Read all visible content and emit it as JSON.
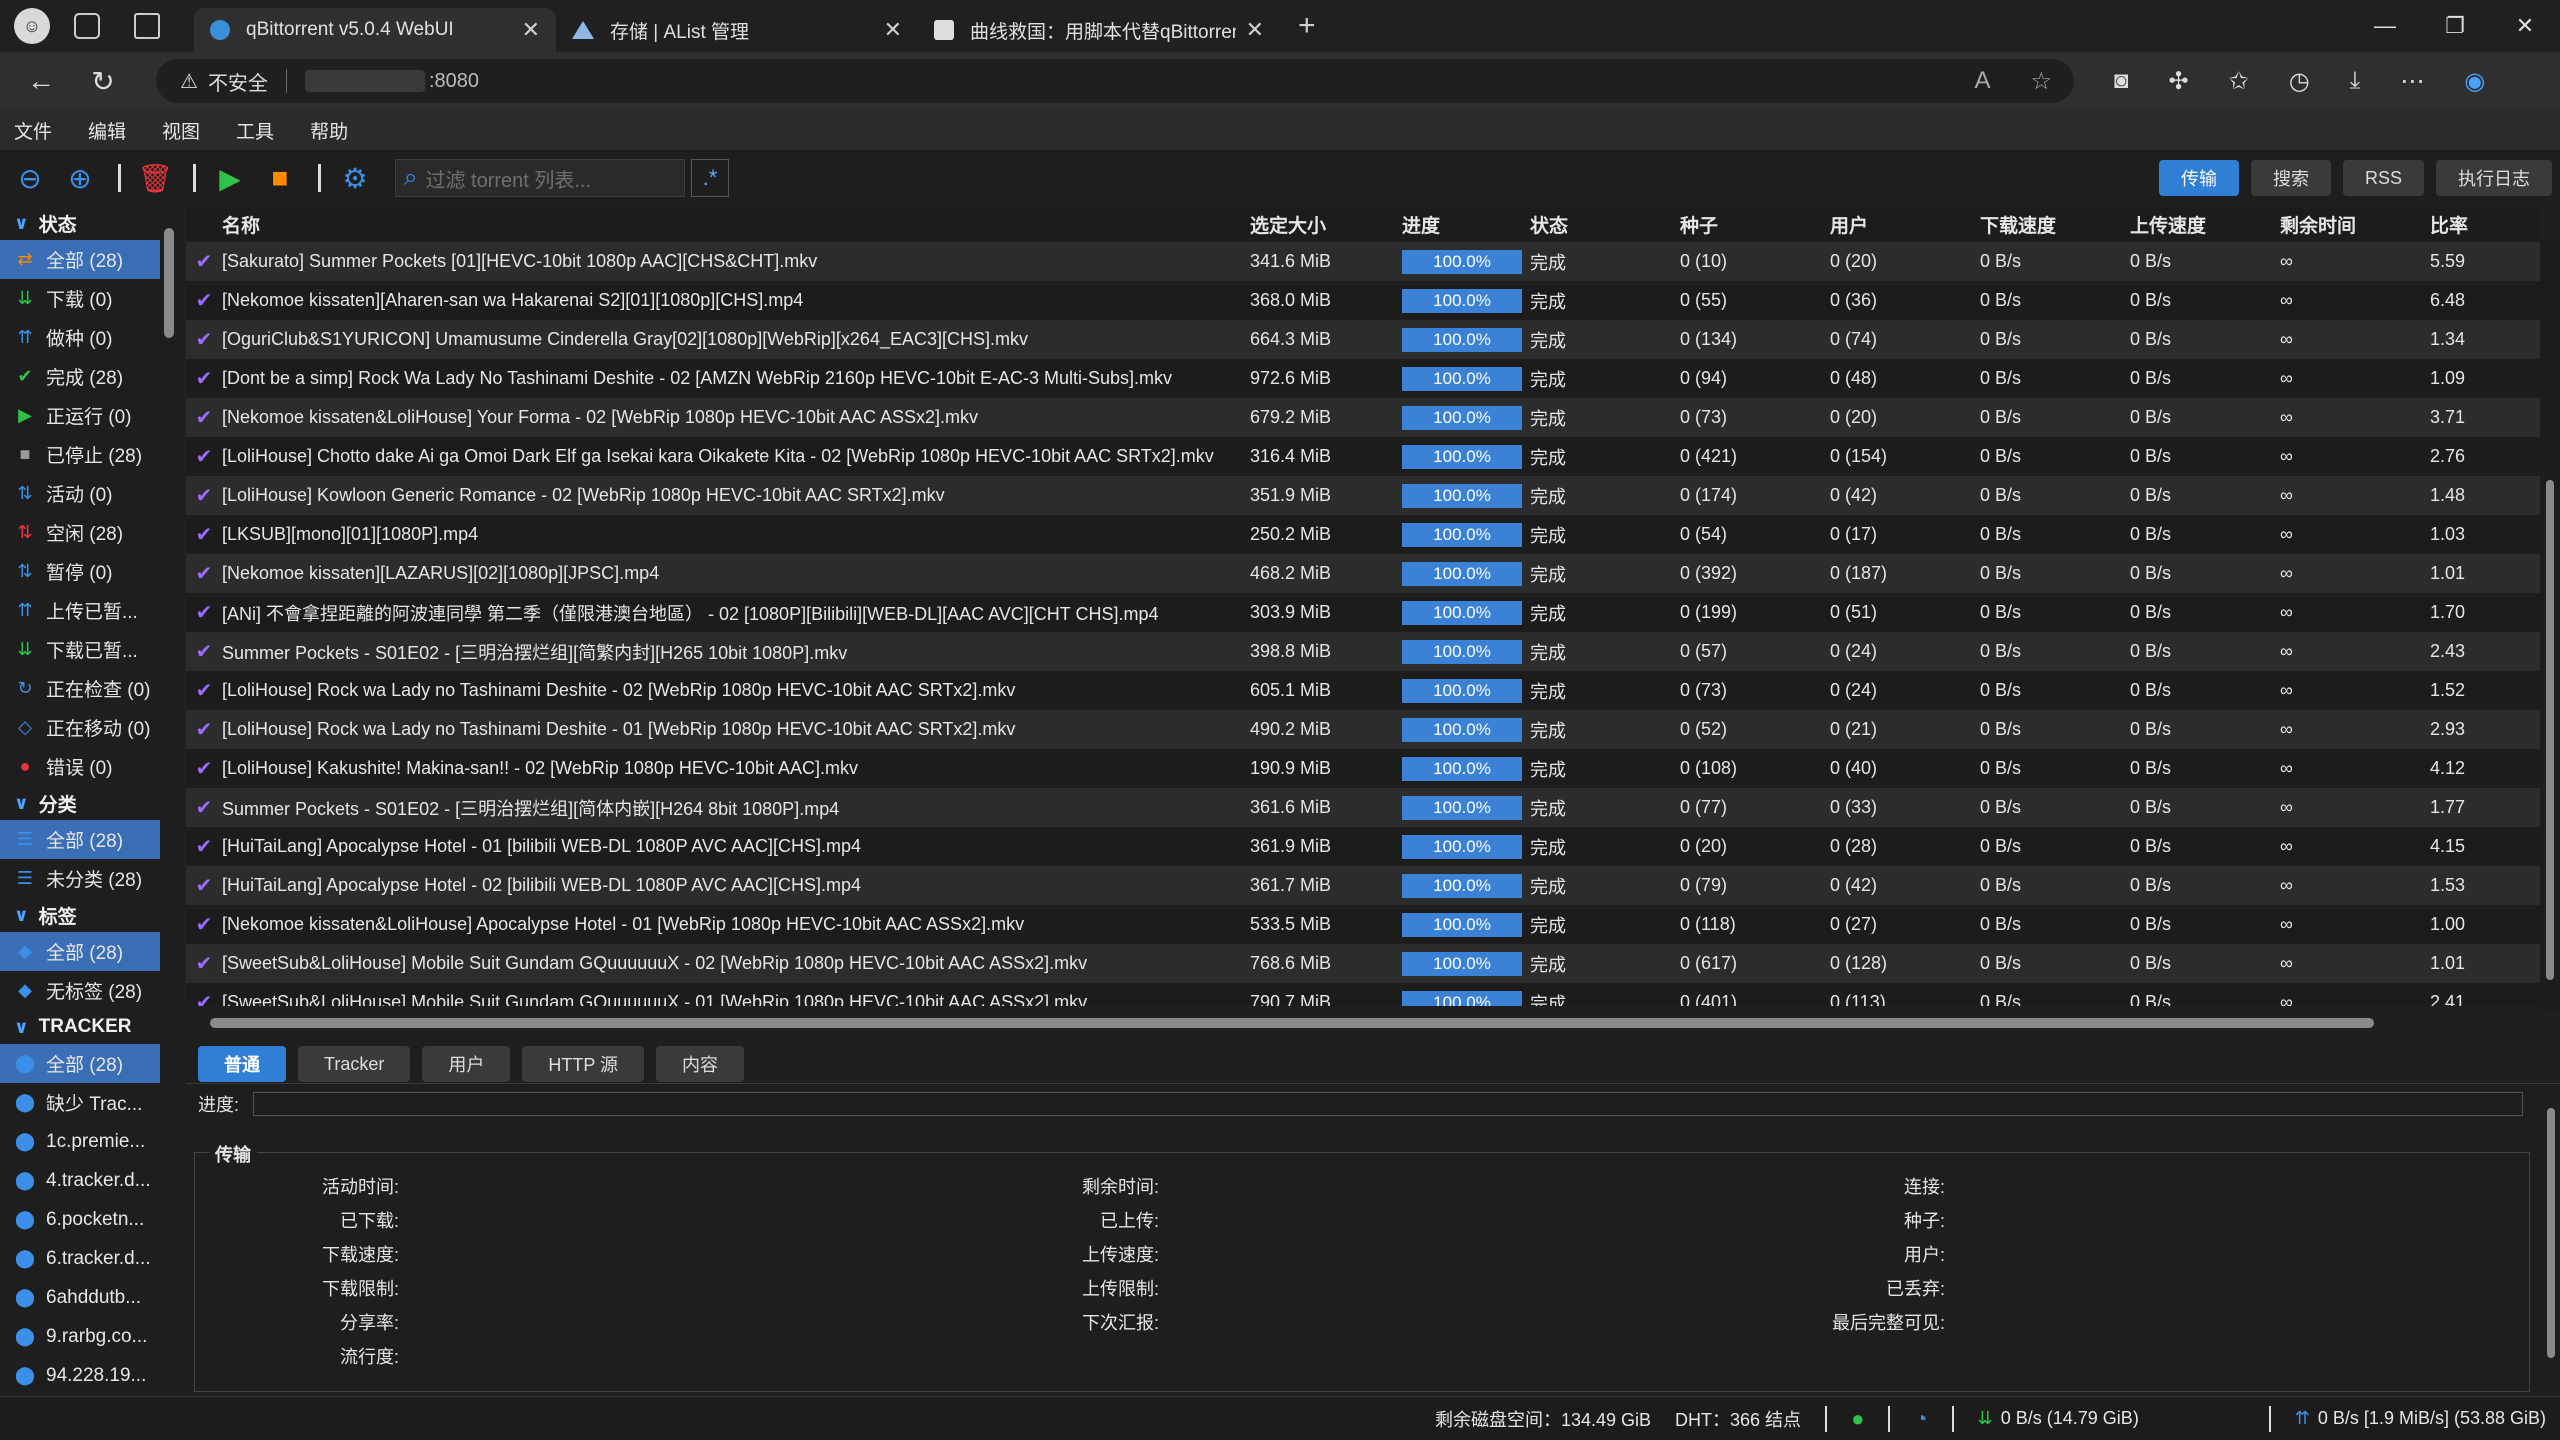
{
  "browser": {
    "tabs": [
      {
        "title": "qBittorrent v5.0.4 WebUI",
        "active": true
      },
      {
        "title": "存储 | AList 管理",
        "active": false
      },
      {
        "title": "曲线救国：用脚本代替qBittorrent",
        "active": false
      }
    ],
    "url_warning": "不安全",
    "url_port": ":8080"
  },
  "menu": [
    "文件",
    "编辑",
    "视图",
    "工具",
    "帮助"
  ],
  "toolbar": {
    "filter_placeholder": "过滤 torrent 列表...",
    "regex": ".*",
    "right_tabs": [
      "传输",
      "搜索",
      "RSS",
      "执行日志"
    ]
  },
  "sidebar": {
    "status_title": "状态",
    "status": [
      {
        "label": "全部 (28)",
        "icon": "shuffle-icon",
        "active": true
      },
      {
        "label": "下载 (0)",
        "icon": "download-icon"
      },
      {
        "label": "做种 (0)",
        "icon": "upload-icon"
      },
      {
        "label": "完成 (28)",
        "icon": "check-icon"
      },
      {
        "label": "正运行 (0)",
        "icon": "play-icon"
      },
      {
        "label": "已停止 (28)",
        "icon": "stop-icon"
      },
      {
        "label": "活动 (0)",
        "icon": "activity-icon"
      },
      {
        "label": "空闲 (28)",
        "icon": "idle-icon"
      },
      {
        "label": "暂停 (0)",
        "icon": "pause-icon"
      },
      {
        "label": "上传已暂...",
        "icon": "upload-paused-icon"
      },
      {
        "label": "下载已暂...",
        "icon": "download-paused-icon"
      },
      {
        "label": "正在检查 (0)",
        "icon": "refresh-icon"
      },
      {
        "label": "正在移动 (0)",
        "icon": "move-icon"
      },
      {
        "label": "错误 (0)",
        "icon": "error-icon"
      }
    ],
    "category_title": "分类",
    "categories": [
      {
        "label": "全部 (28)",
        "active": true
      },
      {
        "label": "未分类 (28)"
      }
    ],
    "tag_title": "标签",
    "tags": [
      {
        "label": "全部 (28)",
        "active": true
      },
      {
        "label": "无标签 (28)"
      }
    ],
    "tracker_title": "TRACKER",
    "trackers": [
      {
        "label": "全部 (28)",
        "active": true
      },
      {
        "label": "缺少 Trac..."
      },
      {
        "label": "1c.premie..."
      },
      {
        "label": "4.tracker.d..."
      },
      {
        "label": "6.pocketn..."
      },
      {
        "label": "6.tracker.d..."
      },
      {
        "label": "6ahddutb..."
      },
      {
        "label": "9.rarbg.co..."
      },
      {
        "label": "94.228.19..."
      }
    ]
  },
  "table": {
    "headers": [
      "名称",
      "选定大小",
      "进度",
      "状态",
      "种子",
      "用户",
      "下载速度",
      "上传速度",
      "剩余时间",
      "比率"
    ],
    "rows": [
      [
        "[Sakurato] Summer Pockets [01][HEVC-10bit 1080p AAC][CHS&CHT].mkv",
        "341.6 MiB",
        "100.0%",
        "完成",
        "0 (10)",
        "0 (20)",
        "0 B/s",
        "0 B/s",
        "∞",
        "5.59"
      ],
      [
        "[Nekomoe kissaten][Aharen-san wa Hakarenai S2][01][1080p][CHS].mp4",
        "368.0 MiB",
        "100.0%",
        "完成",
        "0 (55)",
        "0 (36)",
        "0 B/s",
        "0 B/s",
        "∞",
        "6.48"
      ],
      [
        "[OguriClub&S1YURICON] Umamusume Cinderella Gray[02][1080p][WebRip][x264_EAC3][CHS].mkv",
        "664.3 MiB",
        "100.0%",
        "完成",
        "0 (134)",
        "0 (74)",
        "0 B/s",
        "0 B/s",
        "∞",
        "1.34"
      ],
      [
        "[Dont be a simp] Rock Wa Lady No Tashinami Deshite - 02 [AMZN WebRip 2160p HEVC-10bit E-AC-3 Multi-Subs].mkv",
        "972.6 MiB",
        "100.0%",
        "完成",
        "0 (94)",
        "0 (48)",
        "0 B/s",
        "0 B/s",
        "∞",
        "1.09"
      ],
      [
        "[Nekomoe kissaten&LoliHouse] Your Forma - 02 [WebRip 1080p HEVC-10bit AAC ASSx2].mkv",
        "679.2 MiB",
        "100.0%",
        "完成",
        "0 (73)",
        "0 (20)",
        "0 B/s",
        "0 B/s",
        "∞",
        "3.71"
      ],
      [
        "[LoliHouse] Chotto dake Ai ga Omoi Dark Elf ga Isekai kara Oikakete Kita - 02 [WebRip 1080p HEVC-10bit AAC SRTx2].mkv",
        "316.4 MiB",
        "100.0%",
        "完成",
        "0 (421)",
        "0 (154)",
        "0 B/s",
        "0 B/s",
        "∞",
        "2.76"
      ],
      [
        "[LoliHouse] Kowloon Generic Romance - 02 [WebRip 1080p HEVC-10bit AAC SRTx2].mkv",
        "351.9 MiB",
        "100.0%",
        "完成",
        "0 (174)",
        "0 (42)",
        "0 B/s",
        "0 B/s",
        "∞",
        "1.48"
      ],
      [
        "[LKSUB][mono][01][1080P].mp4",
        "250.2 MiB",
        "100.0%",
        "完成",
        "0 (54)",
        "0 (17)",
        "0 B/s",
        "0 B/s",
        "∞",
        "1.03"
      ],
      [
        "[Nekomoe kissaten][LAZARUS][02][1080p][JPSC].mp4",
        "468.2 MiB",
        "100.0%",
        "完成",
        "0 (392)",
        "0 (187)",
        "0 B/s",
        "0 B/s",
        "∞",
        "1.01"
      ],
      [
        "[ANi] 不會拿捏距離的阿波連同學 第二季（僅限港澳台地區） - 02 [1080P][Bilibili][WEB-DL][AAC AVC][CHT CHS].mp4",
        "303.9 MiB",
        "100.0%",
        "完成",
        "0 (199)",
        "0 (51)",
        "0 B/s",
        "0 B/s",
        "∞",
        "1.70"
      ],
      [
        "Summer Pockets - S01E02 - [三明治摆烂组][简繁内封][H265 10bit 1080P].mkv",
        "398.8 MiB",
        "100.0%",
        "完成",
        "0 (57)",
        "0 (24)",
        "0 B/s",
        "0 B/s",
        "∞",
        "2.43"
      ],
      [
        "[LoliHouse] Rock wa Lady no Tashinami Deshite - 02 [WebRip 1080p HEVC-10bit AAC SRTx2].mkv",
        "605.1 MiB",
        "100.0%",
        "完成",
        "0 (73)",
        "0 (24)",
        "0 B/s",
        "0 B/s",
        "∞",
        "1.52"
      ],
      [
        "[LoliHouse] Rock wa Lady no Tashinami Deshite - 01 [WebRip 1080p HEVC-10bit AAC SRTx2].mkv",
        "490.2 MiB",
        "100.0%",
        "完成",
        "0 (52)",
        "0 (21)",
        "0 B/s",
        "0 B/s",
        "∞",
        "2.93"
      ],
      [
        "[LoliHouse] Kakushite! Makina-san!! - 02 [WebRip 1080p HEVC-10bit AAC].mkv",
        "190.9 MiB",
        "100.0%",
        "完成",
        "0 (108)",
        "0 (40)",
        "0 B/s",
        "0 B/s",
        "∞",
        "4.12"
      ],
      [
        "Summer Pockets - S01E02 - [三明治摆烂组][简体内嵌][H264 8bit 1080P].mp4",
        "361.6 MiB",
        "100.0%",
        "完成",
        "0 (77)",
        "0 (33)",
        "0 B/s",
        "0 B/s",
        "∞",
        "1.77"
      ],
      [
        "[HuiTaiLang] Apocalypse Hotel - 01 [bilibili WEB-DL 1080P AVC AAC][CHS].mp4",
        "361.9 MiB",
        "100.0%",
        "完成",
        "0 (20)",
        "0 (28)",
        "0 B/s",
        "0 B/s",
        "∞",
        "4.15"
      ],
      [
        "[HuiTaiLang] Apocalypse Hotel - 02 [bilibili WEB-DL 1080P AVC AAC][CHS].mp4",
        "361.7 MiB",
        "100.0%",
        "完成",
        "0 (79)",
        "0 (42)",
        "0 B/s",
        "0 B/s",
        "∞",
        "1.53"
      ],
      [
        "[Nekomoe kissaten&LoliHouse] Apocalypse Hotel - 01 [WebRip 1080p HEVC-10bit AAC ASSx2].mkv",
        "533.5 MiB",
        "100.0%",
        "完成",
        "0 (118)",
        "0 (27)",
        "0 B/s",
        "0 B/s",
        "∞",
        "1.00"
      ],
      [
        "[SweetSub&LoliHouse] Mobile Suit Gundam GQuuuuuuX - 02 [WebRip 1080p HEVC-10bit AAC ASSx2].mkv",
        "768.6 MiB",
        "100.0%",
        "完成",
        "0 (617)",
        "0 (128)",
        "0 B/s",
        "0 B/s",
        "∞",
        "1.01"
      ],
      [
        "[SweetSub&LoliHouse] Mobile Suit Gundam GQuuuuuuX - 01 [WebRip 1080p HEVC-10bit AAC ASSx2].mkv",
        "790.7 MiB",
        "100.0%",
        "完成",
        "0 (401)",
        "0 (113)",
        "0 B/s",
        "0 B/s",
        "∞",
        "2.41"
      ]
    ]
  },
  "props": {
    "tabs": [
      "普通",
      "Tracker",
      "用户",
      "HTTP 源",
      "内容"
    ],
    "progress_label": "进度:",
    "transfer_title": "传输",
    "col1": [
      "活动时间:",
      "已下载:",
      "下载速度:",
      "下载限制:",
      "分享率:",
      "流行度:"
    ],
    "col2": [
      "剩余时间:",
      "已上传:",
      "上传速度:",
      "上传限制:",
      "下次汇报:"
    ],
    "col3": [
      "连接:",
      "种子:",
      "用户:",
      "已丢弃:",
      "最后完整可见:"
    ]
  },
  "status": {
    "disk": "剩余磁盘空间：134.49 GiB",
    "dht": "DHT：366 结点",
    "dl": "0 B/s (14.79 GiB)",
    "ul": "0 B/s [1.9 MiB/s] (53.88 GiB)"
  }
}
